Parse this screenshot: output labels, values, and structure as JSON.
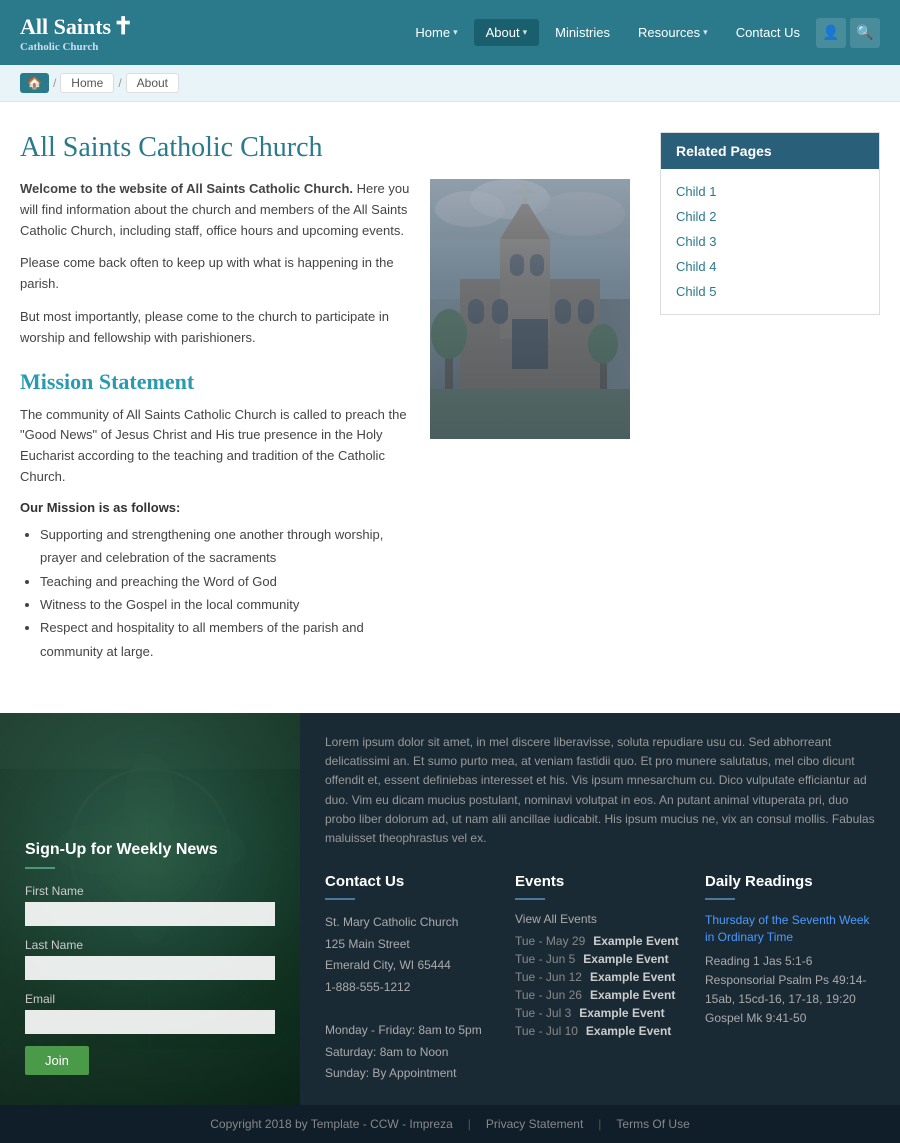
{
  "header": {
    "logo_text": "All Saints",
    "logo_cross": "✝",
    "logo_sub": "Catholic Church",
    "nav": [
      {
        "label": "Home",
        "has_dropdown": true,
        "active": false
      },
      {
        "label": "About",
        "has_dropdown": true,
        "active": true
      },
      {
        "label": "Ministries",
        "has_dropdown": false,
        "active": false
      },
      {
        "label": "Resources",
        "has_dropdown": true,
        "active": false
      },
      {
        "label": "Contact Us",
        "has_dropdown": false,
        "active": false
      }
    ]
  },
  "breadcrumb": {
    "home_icon": "🏠",
    "items": [
      "Home",
      "About"
    ]
  },
  "main": {
    "page_title": "All Saints Catholic Church",
    "intro_bold": "Welcome to the website of All Saints Catholic Church.",
    "intro_text": " Here you will find information about the church and members of the All Saints Catholic Church, including staff, office hours and upcoming events.",
    "para2": "Please come back often to keep up with what is happening in the parish.",
    "para3": "But most importantly, please come to the church to participate in worship and fellowship with parishioners.",
    "mission_title": "Mission Statement",
    "mission_text": "The community of All Saints Catholic Church is called to preach the \"Good News\" of Jesus Christ and His true presence in the Holy Eucharist according to the teaching and tradition of the Catholic Church.",
    "mission_subtitle": "Our Mission is as follows:",
    "mission_items": [
      "Supporting and strengthening one another through worship, prayer and celebration of the sacraments",
      "Teaching and preaching the Word of God",
      "Witness to the Gospel in the local community",
      "Respect and hospitality to all members of the parish and community at large."
    ]
  },
  "related_pages": {
    "title": "Related Pages",
    "items": [
      "Child 1",
      "Child 2",
      "Child 3",
      "Child 4",
      "Child 5"
    ]
  },
  "footer": {
    "newsletter": {
      "title": "Sign-Up for Weekly News",
      "fields": [
        {
          "label": "First Name",
          "placeholder": ""
        },
        {
          "label": "Last Name",
          "placeholder": ""
        },
        {
          "label": "Email",
          "placeholder": ""
        }
      ],
      "button": "Join"
    },
    "lorem": "Lorem ipsum dolor sit amet, in mel discere liberavisse, soluta repudiare usu cu. Sed abhorreant delicatissimi an. Et sumo purto mea, at veniam fastidii quo. Et pro munere salutatus, mel cibo dicunt offendit et, essent definiebas interesset et his. Vis ipsum mnesarchum cu. Dico vulputate efficiantur ad duo. Vim eu dicam mucius postulant, nominavi volutpat in eos. An putant animal vituperata pri, duo probo liber dolorum ad, ut nam alii ancillae iudicabit. His ipsum mucius ne, vix an consul mollis. Fabulas maluisset theophrastus vel ex.",
    "contact": {
      "title": "Contact Us",
      "lines": [
        "St. Mary Catholic Church",
        "125 Main Street",
        "Emerald City, WI  65444",
        "1-888-555-1212",
        "",
        "Monday - Friday: 8am to 5pm",
        "Saturday: 8am to Noon",
        "Sunday: By Appointment"
      ]
    },
    "events": {
      "title": "Events",
      "view_all": "View All Events",
      "items": [
        {
          "date": "Tue - May 29",
          "name": "Example Event"
        },
        {
          "date": "Tue - Jun 5",
          "name": "Example Event"
        },
        {
          "date": "Tue - Jun 12",
          "name": "Example Event"
        },
        {
          "date": "Tue - Jun 26",
          "name": "Example Event"
        },
        {
          "date": "Tue - Jul 3",
          "name": "Example Event"
        },
        {
          "date": "Tue - Jul 10",
          "name": "Example Event"
        }
      ]
    },
    "daily_readings": {
      "title": "Daily Readings",
      "reading_title": "Thursday of the Seventh Week in Ordinary Time",
      "text": "Reading 1 Jas 5:1-6\nResponsorial Psalm Ps 49:14-15ab, 15cd-16, 17-18, 19:20\nGospel Mk 9:41-50"
    },
    "copyright": "Copyright 2018 by Template - CCW - Impreza",
    "privacy": "Privacy Statement",
    "terms": "Terms Of Use"
  }
}
